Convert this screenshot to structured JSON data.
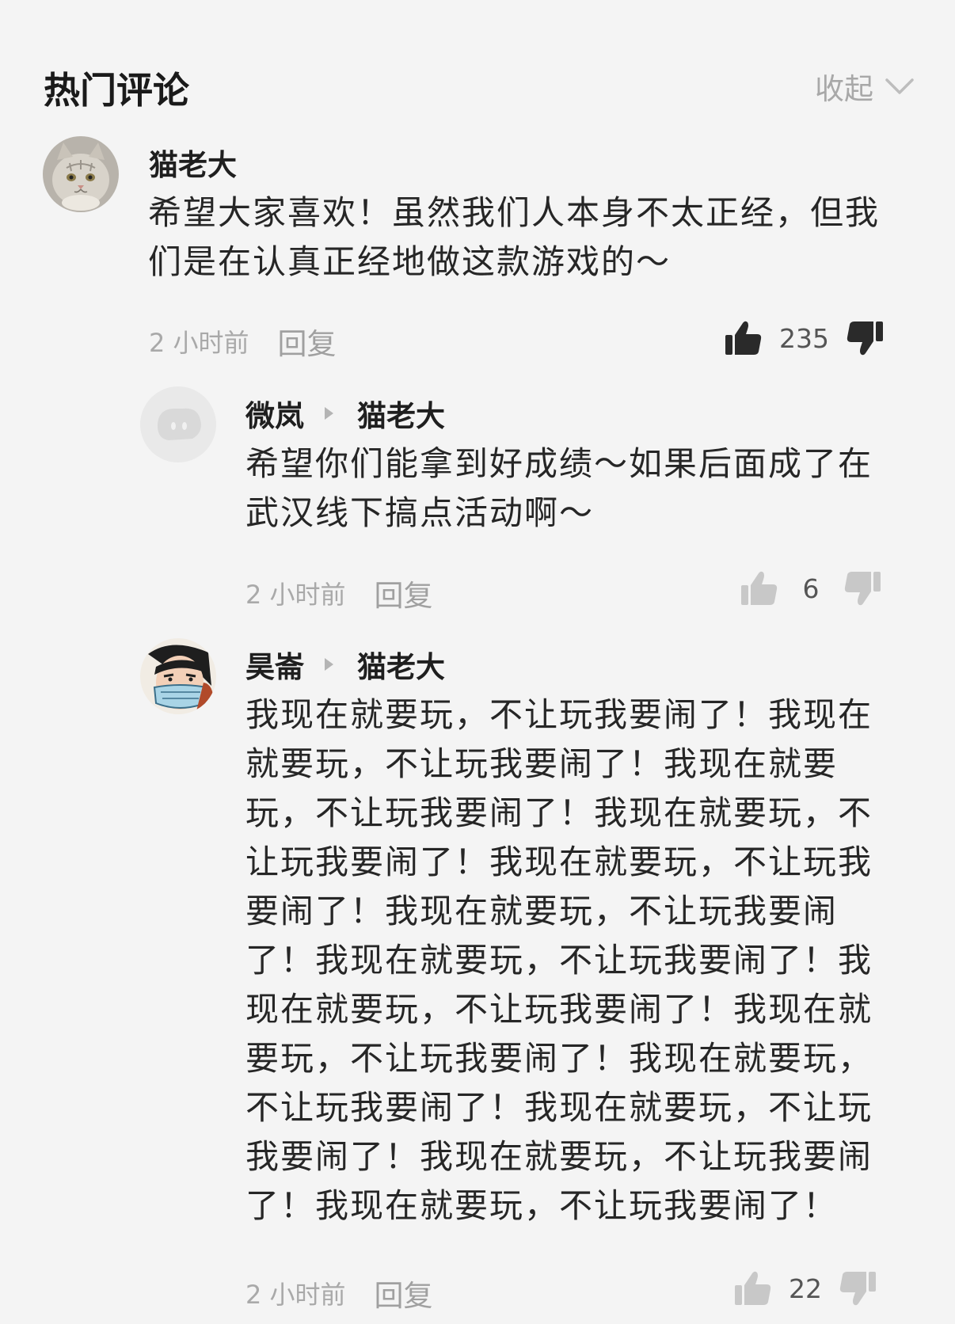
{
  "header": {
    "title": "热门评论",
    "collapse_label": "收起"
  },
  "comments": [
    {
      "author": "猫老大",
      "avatar_icon": "cat-avatar",
      "lines": [
        "希望大家喜欢！虽然我们人本身不太正经，但我",
        "们是在认真正经地做这款游戏的～"
      ],
      "time": "2 小时前",
      "reply_label": "回复",
      "likes": "235",
      "liked": true
    }
  ],
  "replies": [
    {
      "author": "微岚",
      "reply_to": "猫老大",
      "avatar_icon": "default-avatar",
      "lines": [
        "希望你们能拿到好成绩～如果后面成了在",
        "武汉线下搞点活动啊～"
      ],
      "time": "2 小时前",
      "reply_label": "回复",
      "likes": "6",
      "liked": false
    },
    {
      "author": "昊崙",
      "reply_to": "猫老大",
      "avatar_icon": "cartoon-man-mask-avatar",
      "lines": [
        "我现在就要玩，不让玩我要闹了！我现在",
        "就要玩，不让玩我要闹了！我现在就要",
        "玩，不让玩我要闹了！我现在就要玩，不",
        "让玩我要闹了！我现在就要玩，不让玩我",
        "要闹了！我现在就要玩，不让玩我要闹",
        "了！我现在就要玩，不让玩我要闹了！我",
        "现在就要玩，不让玩我要闹了！我现在就",
        "要玩，不让玩我要闹了！我现在就要玩，",
        "不让玩我要闹了！我现在就要玩，不让玩",
        "我要闹了！我现在就要玩，不让玩我要闹",
        "了！我现在就要玩，不让玩我要闹了！"
      ],
      "time": "2 小时前",
      "reply_label": "回复",
      "likes": "22",
      "liked": false
    }
  ],
  "colors": {
    "background": "#f4f4f4",
    "muted": "#a9a9a9",
    "icon_dark": "#2a2a2a",
    "icon_light": "#c8c8c8"
  }
}
